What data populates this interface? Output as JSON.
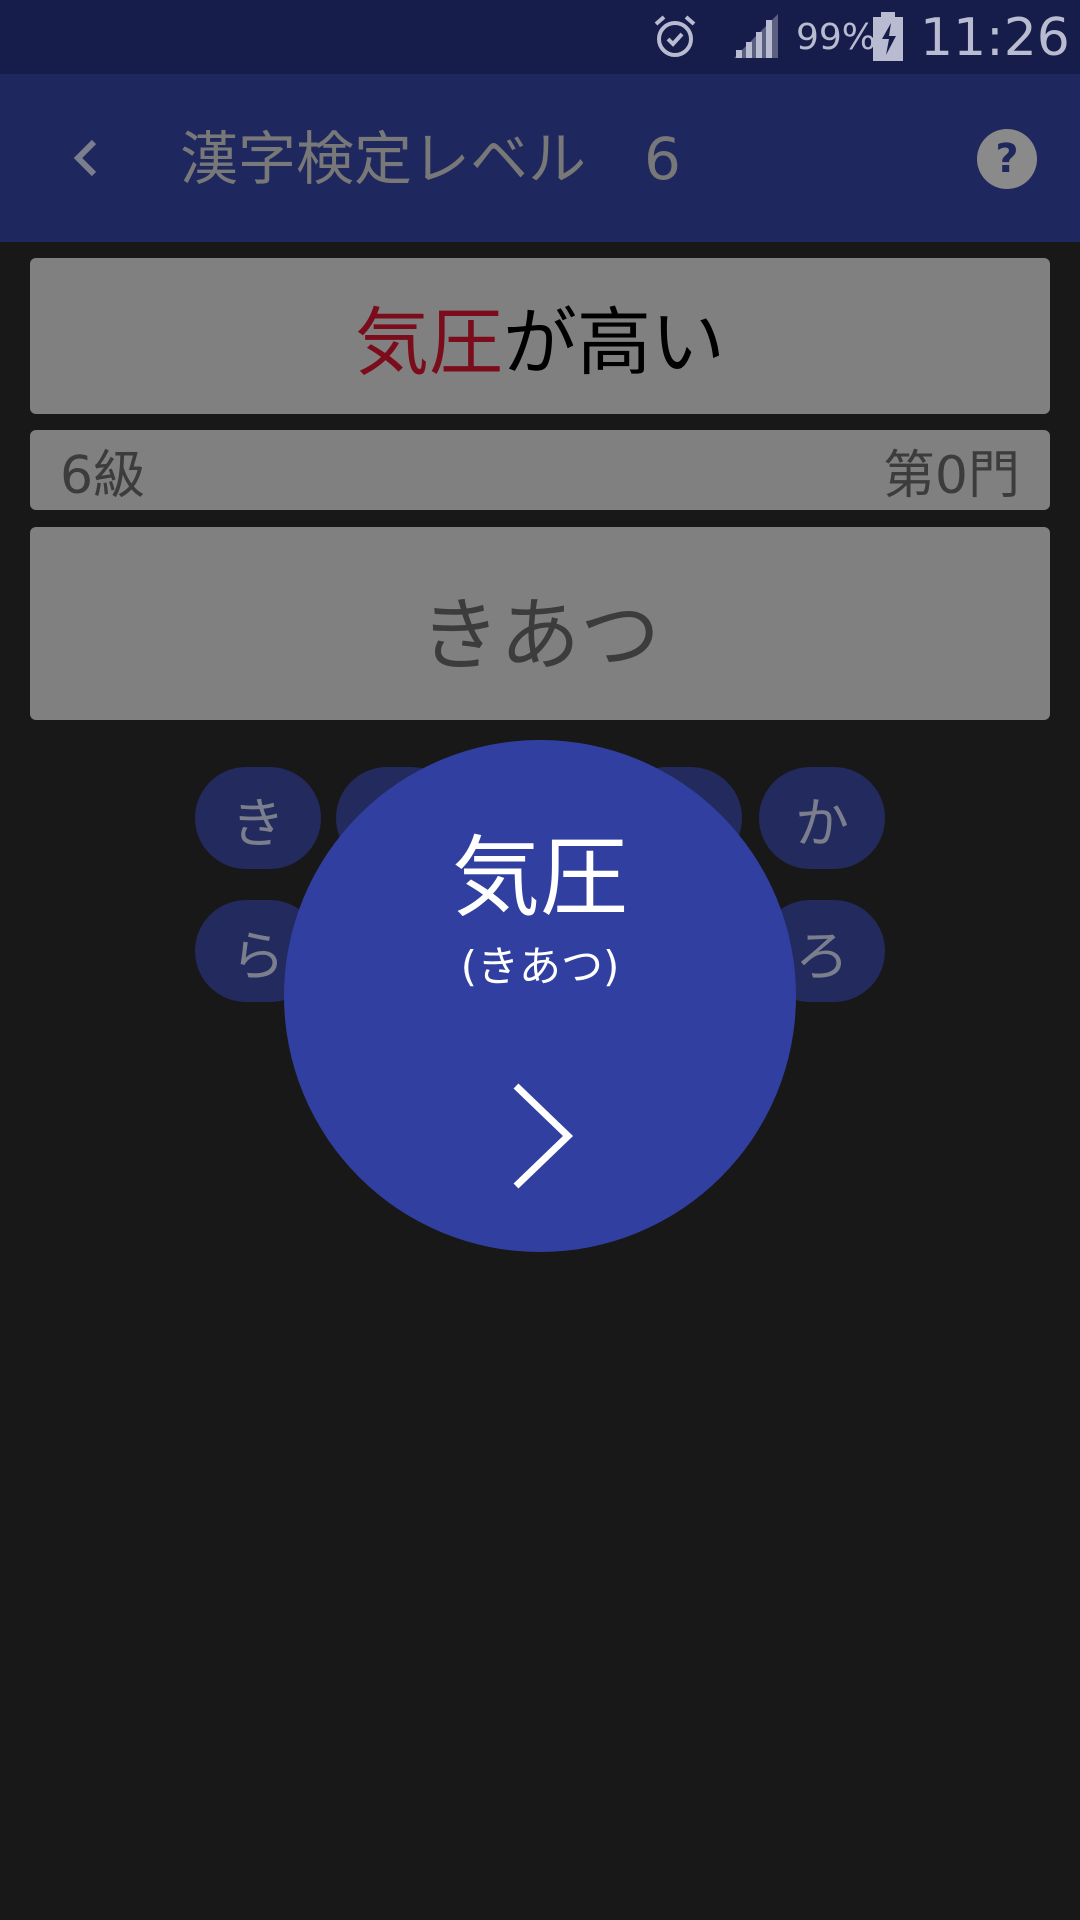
{
  "status_bar": {
    "battery": "99%",
    "time": "11:26",
    "icons": [
      "alarm-icon",
      "signal-icon",
      "battery-charging-icon"
    ]
  },
  "app_bar": {
    "title": "漢字検定レベル　6",
    "icons": [
      "back-arrow-icon",
      "help-icon"
    ]
  },
  "question": {
    "highlight": "気圧",
    "rest": "が高い",
    "highlight_color": "#7a0c1c"
  },
  "info": {
    "level": "6級",
    "number": "第0門"
  },
  "answer": {
    "text": "きあつ"
  },
  "kana_keys": {
    "row1": [
      "き",
      "か"
    ],
    "row2": [
      "ら",
      "ろ"
    ]
  },
  "result": {
    "kanji": "気圧",
    "reading": "(きあつ)",
    "icon": "next-chevron-icon",
    "color": "#3140a0"
  }
}
